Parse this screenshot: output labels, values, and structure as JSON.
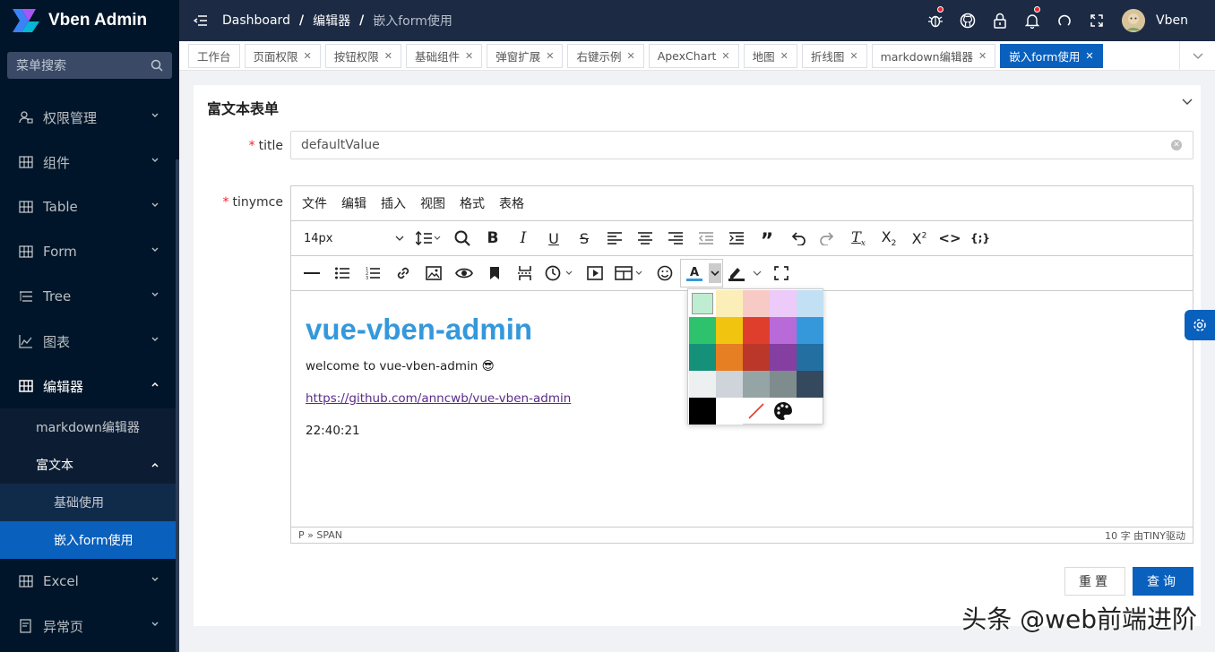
{
  "app": {
    "title": "Vben Admin"
  },
  "sidebar": {
    "search_placeholder": "菜单搜索",
    "items": [
      {
        "label": "权限管理",
        "icon": "user-lock-icon"
      },
      {
        "label": "组件",
        "icon": "grid-icon"
      },
      {
        "label": "Table",
        "icon": "table-icon"
      },
      {
        "label": "Form",
        "icon": "form-icon"
      },
      {
        "label": "Tree",
        "icon": "tree-icon"
      },
      {
        "label": "图表",
        "icon": "chart-icon"
      },
      {
        "label": "编辑器",
        "icon": "editor-icon"
      },
      {
        "label": "Excel",
        "icon": "excel-icon"
      },
      {
        "label": "异常页",
        "icon": "exception-icon"
      }
    ],
    "editor_sub": {
      "markdown": "markdown编辑器",
      "richtext": "富文本",
      "basic": "基础使用",
      "embed": "嵌入form使用"
    }
  },
  "header": {
    "breadcrumb": [
      "Dashboard",
      "编辑器",
      "嵌入form使用"
    ],
    "user": "Vben"
  },
  "tabs": [
    {
      "label": "工作台",
      "closable": false
    },
    {
      "label": "页面权限",
      "closable": true
    },
    {
      "label": "按钮权限",
      "closable": true
    },
    {
      "label": "基础组件",
      "closable": true
    },
    {
      "label": "弹窗扩展",
      "closable": true
    },
    {
      "label": "右键示例",
      "closable": true
    },
    {
      "label": "ApexChart",
      "closable": true
    },
    {
      "label": "地图",
      "closable": true
    },
    {
      "label": "折线图",
      "closable": true
    },
    {
      "label": "markdown编辑器",
      "closable": true
    },
    {
      "label": "嵌入form使用",
      "closable": true,
      "active": true
    }
  ],
  "form": {
    "card_title": "富文本表单",
    "title_label": "title",
    "title_value": "defaultValue",
    "tinymce_label": "tinymce",
    "reset": "重置",
    "submit": "查询"
  },
  "editor": {
    "menu": [
      "文件",
      "编辑",
      "插入",
      "视图",
      "格式",
      "表格"
    ],
    "font_size": "14px",
    "heading": "vue-vben-admin",
    "welcome": "welcome to vue-vben-admin 😎",
    "link": "https://github.com/anncwb/vue-vben-admin",
    "time": "22:40:21",
    "path": "P » SPAN",
    "status_right": "10 字  由TINY驱动"
  },
  "palette": {
    "colors": [
      "#bfedd2",
      "#fbeeb8",
      "#f8cac6",
      "#eccafa",
      "#c2e0f4",
      "#2dc26b",
      "#f1c40f",
      "#e03e2d",
      "#b96ad9",
      "#3598db",
      "#169179",
      "#e67e23",
      "#ba372a",
      "#843fa1",
      "#236fa1",
      "#ecf0f1",
      "#ced4d9",
      "#95a5a6",
      "#7e8c8d",
      "#34495e",
      "#000000",
      "#ffffff"
    ]
  },
  "watermark": "头条 @web前端进阶",
  "colors": {
    "primary": "#0960bd",
    "sidebar": "#001529",
    "header": "#1c2a44"
  }
}
